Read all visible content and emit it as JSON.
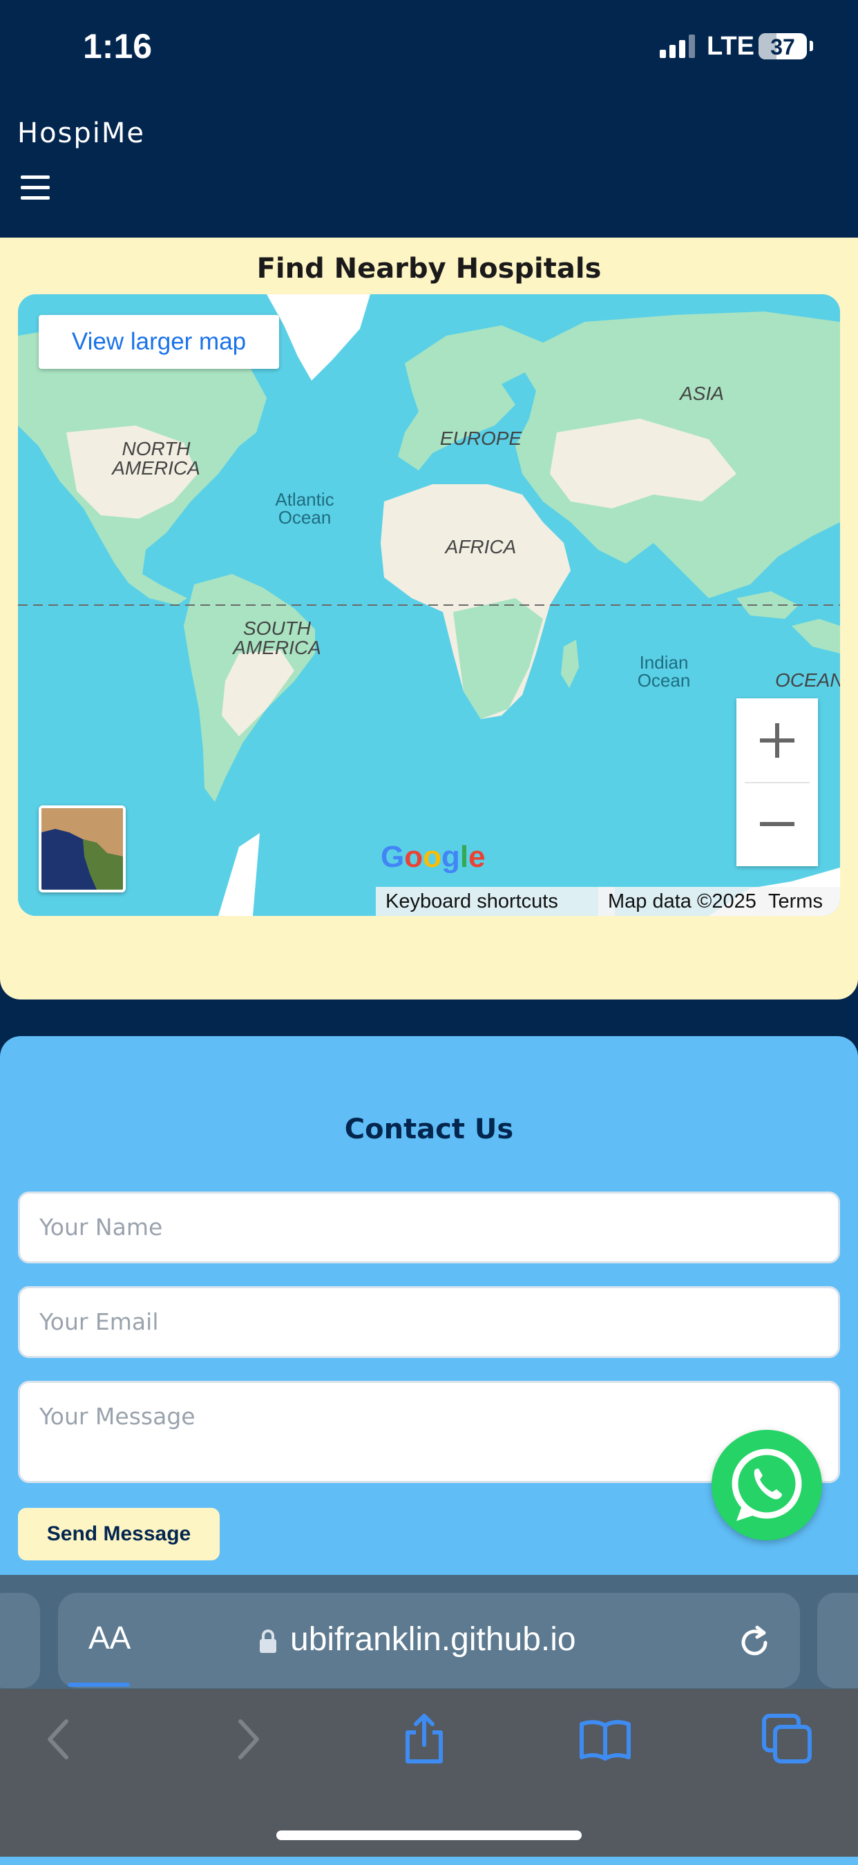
{
  "status_bar": {
    "time": "1:16",
    "network": "LTE",
    "battery": "37",
    "battery_level": 0.37
  },
  "header": {
    "brand": "HospiMe",
    "menu_icon": "hamburger-icon"
  },
  "map_section": {
    "title": "Find Nearby Hospitals",
    "view_larger": "View larger map",
    "labels": {
      "north_america": "NORTH\nAMERICA",
      "south_america": "SOUTH\nAMERICA",
      "europe": "EUROPE",
      "africa": "AFRICA",
      "asia": "ASIA",
      "atlantic": "Atlantic\nOcean",
      "indian": "Indian\nOcean",
      "ocean_partial": "OCEAN"
    },
    "zoom_in": "+",
    "zoom_out": "−",
    "logo": "Google",
    "shortcuts": "Keyboard shortcuts",
    "map_data": "Map data ©2025",
    "terms": "Terms"
  },
  "contact": {
    "title": "Contact Us",
    "name_placeholder": "Your Name",
    "email_placeholder": "Your Email",
    "message_placeholder": "Your Message",
    "send_label": "Send Message",
    "whatsapp_icon": "whatsapp-icon"
  },
  "browser": {
    "aa_label": "AA",
    "url": "ubifranklin.github.io",
    "icons": [
      "back-icon",
      "forward-icon",
      "share-icon",
      "bookmarks-icon",
      "tabs-icon"
    ]
  },
  "colors": {
    "header_bg": "#03264f",
    "map_section_bg": "#fef5c5",
    "contact_bg": "#60bdf6",
    "ocean": "#5ad0e6",
    "link_blue": "#1a73e8",
    "whatsapp_green": "#25d366"
  }
}
